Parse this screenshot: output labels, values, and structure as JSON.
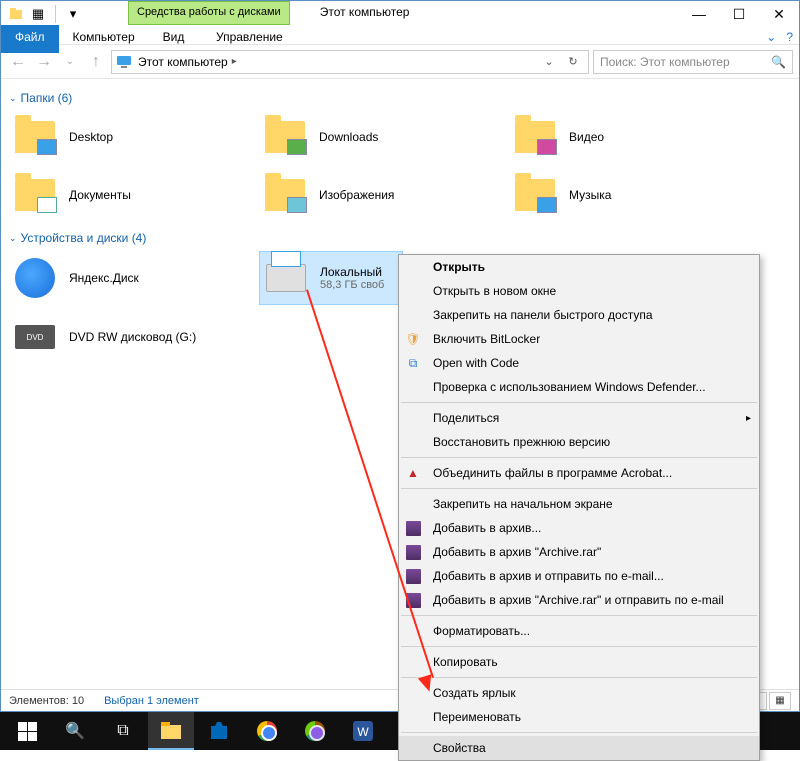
{
  "titlebar": {
    "context_tab": "Средства работы с дисками",
    "title": "Этот компьютер",
    "minimize": "—",
    "maximize": "☐",
    "close": "✕"
  },
  "ribbon": {
    "file": "Файл",
    "computer": "Компьютер",
    "view": "Вид",
    "manage": "Управление",
    "expand": "⌄",
    "help": "?"
  },
  "nav": {
    "back": "←",
    "forward": "→",
    "recent": "⌄",
    "up": "↑"
  },
  "address": {
    "location": "Этот компьютер",
    "refresh": "↻",
    "dropdown": "⌄",
    "search_placeholder": "Поиск: Этот компьютер"
  },
  "groups": {
    "folders_label": "Папки (6)",
    "devices_label": "Устройства и диски (4)"
  },
  "folders": {
    "desktop": "Desktop",
    "downloads": "Downloads",
    "videos": "Видео",
    "documents": "Документы",
    "pictures": "Изображения",
    "music": "Музыка"
  },
  "devices": {
    "yadisk": "Яндекс.Диск",
    "localdisk": {
      "name": "Локальный",
      "sub": "58,3 ГБ своб"
    },
    "dvd": "DVD RW дисковод (G:)",
    "dvd_badge": "DVD"
  },
  "context_menu": {
    "open": "Открыть",
    "open_new": "Открыть в новом окне",
    "pin_quick": "Закрепить на панели быстрого доступа",
    "bitlocker": "Включить BitLocker",
    "open_code": "Open with Code",
    "defender": "Проверка с использованием Windows Defender...",
    "share": "Поделиться",
    "restore": "Восстановить прежнюю версию",
    "acrobat": "Объединить файлы в программе Acrobat...",
    "pin_start": "Закрепить на начальном экране",
    "add_archive": "Добавить в архив...",
    "add_archive_rar": "Добавить в архив \"Archive.rar\"",
    "add_send": "Добавить в архив и отправить по e-mail...",
    "add_send_rar": "Добавить в архив \"Archive.rar\" и отправить по e-mail",
    "format": "Форматировать...",
    "copy": "Копировать",
    "shortcut": "Создать ярлык",
    "rename": "Переименовать",
    "properties": "Свойства"
  },
  "statusbar": {
    "count": "Элементов: 10",
    "selection": "Выбран 1 элемент"
  }
}
